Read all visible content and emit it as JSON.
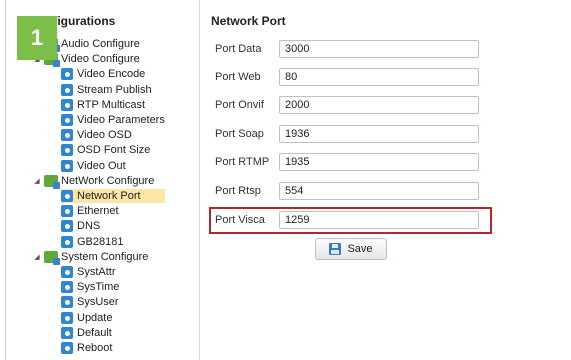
{
  "badge": "1",
  "sidebar": {
    "title": "Configurations",
    "items": [
      {
        "label": "Audio Configure",
        "level": 0,
        "type": "folder",
        "expanded": false
      },
      {
        "label": "Video Configure",
        "level": 0,
        "type": "folder",
        "expanded": true
      },
      {
        "label": "Video Encode",
        "level": 1,
        "type": "leaf"
      },
      {
        "label": "Stream Publish",
        "level": 1,
        "type": "leaf"
      },
      {
        "label": "RTP Multicast",
        "level": 1,
        "type": "leaf"
      },
      {
        "label": "Video Parameters",
        "level": 1,
        "type": "leaf"
      },
      {
        "label": "Video OSD",
        "level": 1,
        "type": "leaf"
      },
      {
        "label": "OSD Font Size",
        "level": 1,
        "type": "leaf"
      },
      {
        "label": "Video Out",
        "level": 1,
        "type": "leaf"
      },
      {
        "label": "NetWork Configure",
        "level": 0,
        "type": "folder",
        "expanded": true
      },
      {
        "label": "Network Port",
        "level": 1,
        "type": "leaf",
        "selected": true
      },
      {
        "label": "Ethernet",
        "level": 1,
        "type": "leaf"
      },
      {
        "label": "DNS",
        "level": 1,
        "type": "leaf"
      },
      {
        "label": "GB28181",
        "level": 1,
        "type": "leaf"
      },
      {
        "label": "System Configure",
        "level": 0,
        "type": "folder",
        "expanded": true
      },
      {
        "label": "SystAttr",
        "level": 1,
        "type": "leaf"
      },
      {
        "label": "SysTime",
        "level": 1,
        "type": "leaf"
      },
      {
        "label": "SysUser",
        "level": 1,
        "type": "leaf"
      },
      {
        "label": "Update",
        "level": 1,
        "type": "leaf"
      },
      {
        "label": "Default",
        "level": 1,
        "type": "leaf"
      },
      {
        "label": "Reboot",
        "level": 1,
        "type": "leaf"
      }
    ]
  },
  "main": {
    "title": "Network Port",
    "fields": [
      {
        "label": "Port Data",
        "value": "3000"
      },
      {
        "label": "Port Web",
        "value": "80"
      },
      {
        "label": "Port Onvif",
        "value": "2000"
      },
      {
        "label": "Port Soap",
        "value": "1936"
      },
      {
        "label": "Port RTMP",
        "value": "1935"
      },
      {
        "label": "Port Rtsp",
        "value": "554"
      },
      {
        "label": "Port Visca",
        "value": "1259",
        "highlighted": true
      }
    ],
    "save_label": "Save"
  },
  "colors": {
    "badge": "#7bbf49",
    "selection": "#fbe6a6",
    "highlight_border": "#b5262b",
    "leaf_icon": "#2f86d1",
    "folder_icon": "#5fa83c"
  }
}
